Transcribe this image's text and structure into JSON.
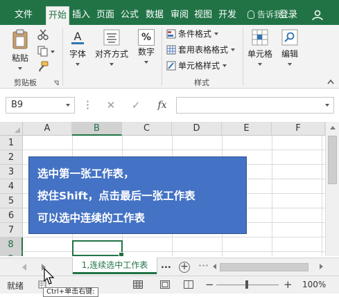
{
  "tabs": [
    {
      "label": "文件",
      "active": false
    },
    {
      "label": "开始",
      "active": true
    },
    {
      "label": "插入",
      "active": false
    },
    {
      "label": "页面",
      "active": false
    },
    {
      "label": "公式",
      "active": false
    },
    {
      "label": "数据",
      "active": false
    },
    {
      "label": "审阅",
      "active": false
    },
    {
      "label": "视图",
      "active": false
    },
    {
      "label": "开发",
      "active": false
    }
  ],
  "tell_me": "告诉我...",
  "login": "登录",
  "ribbon": {
    "paste": "粘贴",
    "clipboard_group": "剪贴板",
    "font": "字体",
    "alignment": "对齐方式",
    "number": "数字",
    "number_symbol": "%",
    "conditional_format": "条件格式",
    "table_format": "套用表格格式",
    "cell_style": "单元格样式",
    "styles_group": "样式",
    "cells": "单元格",
    "editing": "编辑"
  },
  "formula_bar": {
    "name_box": "B9",
    "cancel": "✕",
    "enter": "✓",
    "fx": "fx",
    "value": ""
  },
  "columns": [
    "A",
    "B",
    "C",
    "D",
    "E",
    "F"
  ],
  "rows": [
    "1",
    "2",
    "3",
    "4",
    "5",
    "6",
    "7",
    "8",
    "9"
  ],
  "selected_column": "B",
  "selected_row": "9",
  "note": {
    "line1": "选中第一张工作表，",
    "line2": "按住Shift，点击最后一张工作表",
    "line3": "可以选中连续的工作表"
  },
  "sheet_tab": "1,连续选中工作表",
  "sheet_more": "...",
  "status": "就绪",
  "zoom": "100%",
  "tooltip": "Ctrl+单击右键:",
  "colors": {
    "accent": "#217346",
    "note_fill": "#4472c4"
  }
}
